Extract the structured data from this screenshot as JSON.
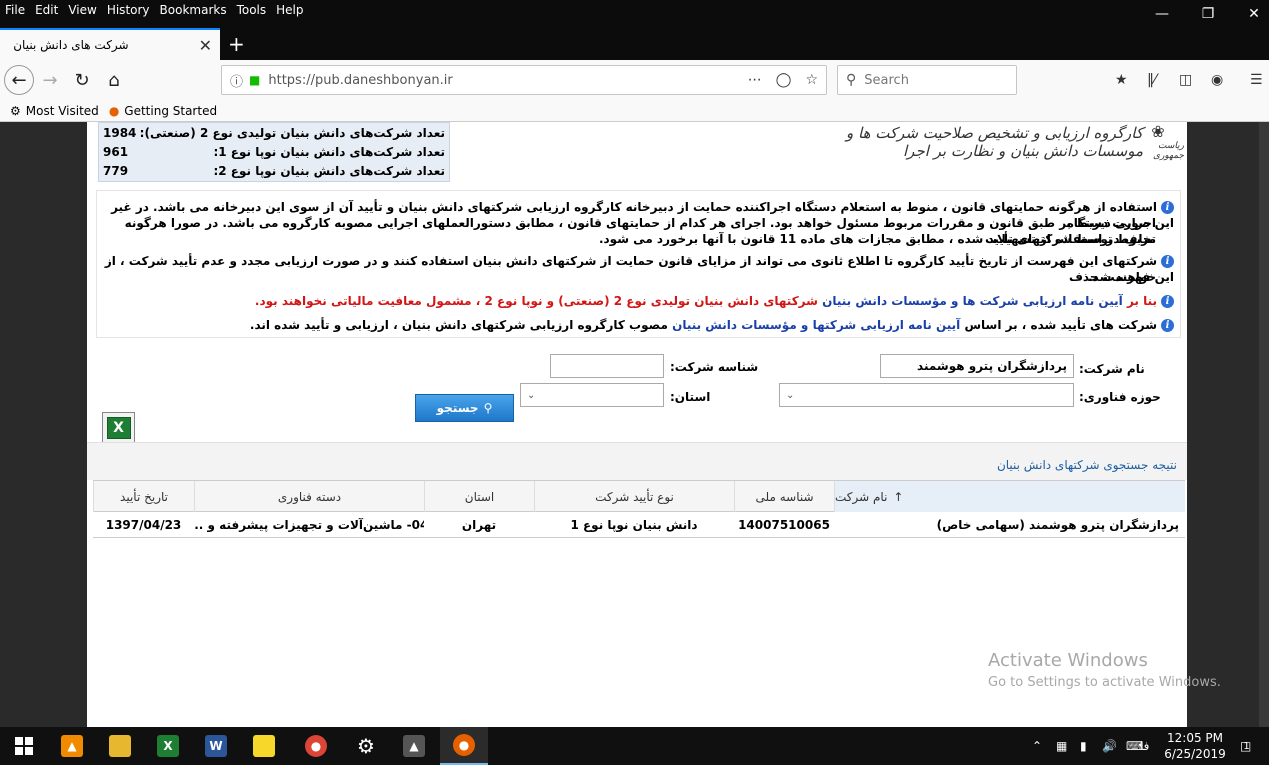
{
  "menubar": {
    "items": [
      "File",
      "Edit",
      "View",
      "History",
      "Bookmarks",
      "Tools",
      "Help"
    ]
  },
  "tab": {
    "title": "شرکت های دانش بنیان"
  },
  "nav": {
    "url": "https://pub.daneshbonyan.ir",
    "search_placeholder": "Search"
  },
  "bookmarks": [
    {
      "label": "Most Visited",
      "icon": "gear-icon"
    },
    {
      "label": "Getting Started",
      "icon": "firefox-icon"
    }
  ],
  "header": {
    "logo_text": "کارگروه ارزیابی و تشخیص صلاحیت شرکت ها و موسسات دانش بنیان و نظارت بر اجرا",
    "logo_caption": "ریاست جمهوری",
    "stats": [
      {
        "label": "تعداد شرکت‌های دانش بنیان تولیدی نوع 2 (صنعتی):",
        "value": "1984"
      },
      {
        "label": "تعداد شرکت‌های دانش بنیان نوپا نوع 1:",
        "value": "961"
      },
      {
        "label": "تعداد شرکت‌های دانش بنیان نوپا نوع 2:",
        "value": "779"
      }
    ]
  },
  "notices": {
    "n1_l1": "استفاده از هرگونه حمایتهای قانون ، منوط به استعلام دستگاه اجراکننده حمایت از دبیرخانه کارگروه ارزیابی شرکتهای دانش بنیان و تأیید آن از سوی این دبیرخانه می باشد. در غیر این صورت دستگاه",
    "n1_l2": "اجرایی ذیربط بر طبق قانون و مقررات مربوط مسئول خواهد بود. اجرای هر کدام از حمایتهای قانون ، مطابق دستورالعملهای اجرایی مصوبه کارگروه می باشد. در صورا هرگونه تخلف در استفاده از تسهیلات",
    "n1_l3": "مربوط توسط شرکتهای تأیید شده ، مطابق مجازات های ماده 11 قانون با آنها برخورد می شود.",
    "n2_l1": "شرکتهای این فهرست از تاریخ تأیید کارگروه تا اطلاع ثانوی می تواند از مزایای قانون حمایت از شرکتهای دانش بنیان استفاده کنند و در صورت ارزیابی مجدد و عدم تأیید شرکت ، از این فهرست حذف",
    "n2_l2": "خواهند شد.",
    "n3_a": "بنا بر",
    "n3_link": "آیین نامه ارزیابی شرکت ها و مؤسسات دانش بنیان",
    "n3_b": "شرکتهای دانش بنیان تولیدی نوع 2 (صنعتی) و نوپا نوع 2 ، مشمول معافیت مالیاتی نخواهند بود.",
    "n4_a": "شرکت های تأیید شده ، بر اساس",
    "n4_link": "آیین نامه ارزیابی شرکتها و مؤسسات دانش بنیان",
    "n4_b": "مصوب کارگروه ارزیابی شرکتهای دانش بنیان ، ارزیابی و تأیید شده اند."
  },
  "form": {
    "company_name_label": "نام شرکت:",
    "company_name_value": "پردازشگران پترو هوشمند",
    "company_id_label": "شناسه شرکت:",
    "company_id_value": "",
    "tech_field_label": "حوزه فناوری:",
    "province_label": "استان:",
    "search_button": "جستجو"
  },
  "results": {
    "title": "نتیجه جستجوی شرکتهای دانش بنیان",
    "columns": [
      "نام شرکت",
      "شناسه ملی",
      "نوع تأیید شرکت",
      "استان",
      "دسته فناوری",
      "تاریخ تأیید"
    ],
    "rows": [
      [
        "پردازشگران پترو هوشمند (سهامی خاص)",
        "14007510065",
        "دانش بنیان نوپا نوع 1",
        "تهران",
        "04- ماشین‌آلات و تجهیزات پیشرفته و ...",
        "1397/04/23"
      ]
    ]
  },
  "watermark": {
    "line1": "Activate Windows",
    "line2": "Go to Settings to activate Windows."
  },
  "taskbar": {
    "lang": "فا",
    "time": "12:05 PM",
    "date": "6/25/2019",
    "notifications": "1"
  }
}
